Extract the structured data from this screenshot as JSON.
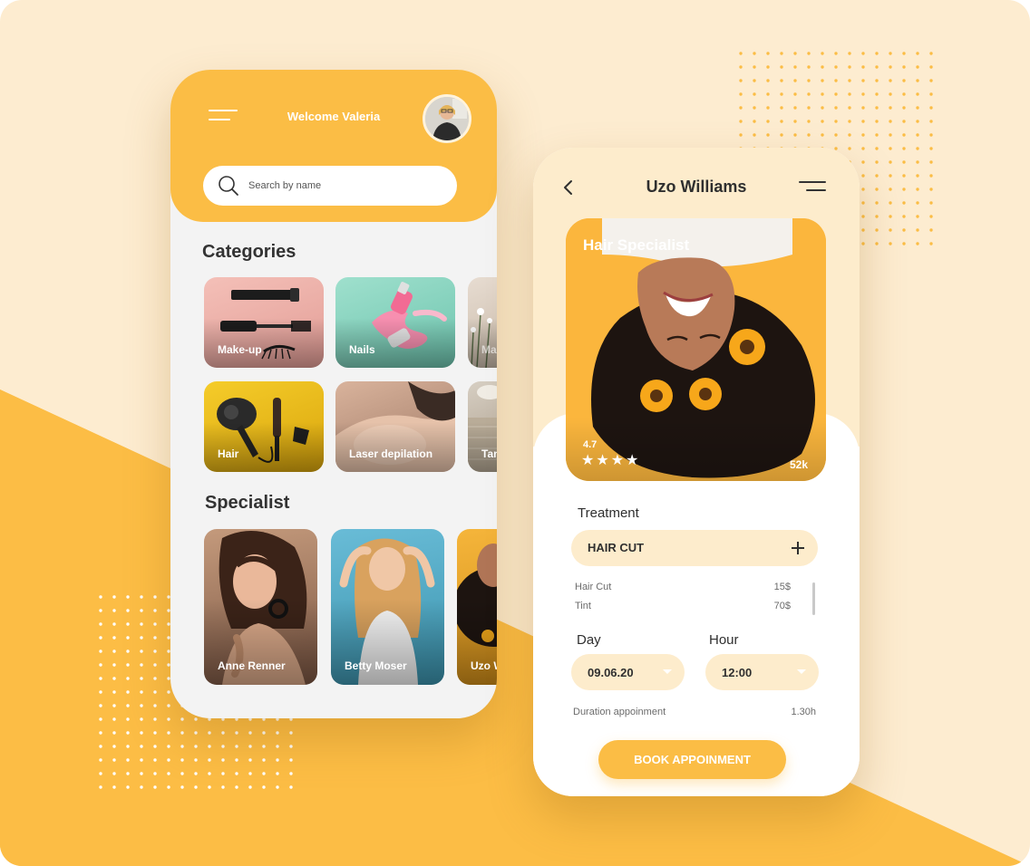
{
  "colors": {
    "accent": "#fbbd45",
    "accent_soft": "#fdeccc",
    "background": "#fdecd0",
    "text_dark": "#2f2f2f"
  },
  "left_screen": {
    "menu_icon": "hamburger-icon",
    "welcome_text": "Welcome Valeria",
    "avatar_icon": "user-avatar",
    "search": {
      "icon": "search-icon",
      "placeholder": "Search by name",
      "value": ""
    },
    "categories_title": "Categories",
    "categories": [
      {
        "label": "Make-up"
      },
      {
        "label": "Nails"
      },
      {
        "label": "Ma"
      },
      {
        "label": "Hair"
      },
      {
        "label": "Laser depilation"
      },
      {
        "label": "Tan"
      }
    ],
    "specialist_title": "Specialist",
    "specialists": [
      {
        "name": "Anne Renner"
      },
      {
        "name": "Betty Moser"
      },
      {
        "name": "Uzo W"
      }
    ]
  },
  "right_screen": {
    "back_icon": "chevron-left-icon",
    "title": "Uzo Williams",
    "menu_icon": "hamburger-icon",
    "hero": {
      "role": "Hair Specialist",
      "rating": "4.7",
      "stars": 4,
      "reviews": "52k"
    },
    "treatment_title": "Treatment",
    "treatment_select": {
      "value": "HAIR CUT",
      "icon": "plus-icon"
    },
    "prices": [
      {
        "name": "Hair Cut",
        "price": "15$"
      },
      {
        "name": "Tint",
        "price": "70$"
      }
    ],
    "day_title": "Day",
    "day_value": "09.06.20",
    "hour_title": "Hour",
    "hour_value": "12:00",
    "duration_label": "Duration appoinment",
    "duration_value": "1.30h",
    "book_button": "BOOK APPOINMENT"
  }
}
